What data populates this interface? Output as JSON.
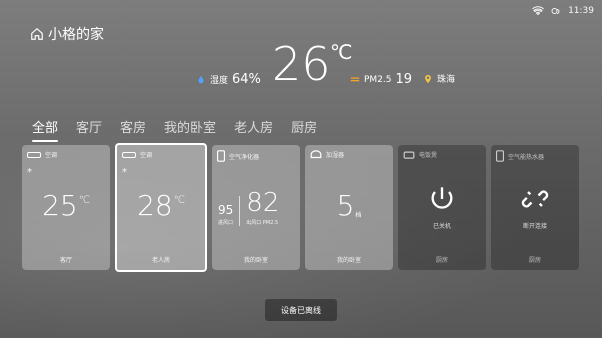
{
  "status": {
    "time": "11:39"
  },
  "home": {
    "title": "小格的家"
  },
  "weather": {
    "temperature": "26",
    "temperature_unit": "℃",
    "humidity_label": "湿度",
    "humidity_value": "64%",
    "pm_label": "PM2.5",
    "pm_value": "19",
    "city": "珠海"
  },
  "tabs": [
    {
      "label": "全部",
      "active": true
    },
    {
      "label": "客厅",
      "active": false
    },
    {
      "label": "客房",
      "active": false
    },
    {
      "label": "我的卧室",
      "active": false
    },
    {
      "label": "老人房",
      "active": false
    },
    {
      "label": "厨房",
      "active": false
    }
  ],
  "cards": [
    {
      "name": "空调",
      "value": "25",
      "unit": "℃",
      "room": "客厅",
      "icon": "ac-icon",
      "mode": "*"
    },
    {
      "name": "空调",
      "value": "28",
      "unit": "℃",
      "room": "老人房",
      "icon": "ac-icon",
      "mode": "*"
    },
    {
      "name": "空气净化器",
      "room": "我的卧室",
      "icon": "air-purifier-icon",
      "aq1_value": "95",
      "aq1_label": "进风口",
      "aq2_value": "82",
      "aq2_label": "出风口 PM2.5"
    },
    {
      "name": "加湿器",
      "value": "5",
      "unit": "档",
      "room": "我的卧室",
      "icon": "humidifier-icon"
    },
    {
      "name": "电饭煲",
      "room": "厨房",
      "icon": "rice-cooker-icon",
      "state_text": "已关机"
    },
    {
      "name": "空气能热水器",
      "room": "厨房",
      "icon": "water-heater-icon",
      "state_text": "断开连接"
    }
  ],
  "toast": {
    "message": "设备已离线"
  }
}
